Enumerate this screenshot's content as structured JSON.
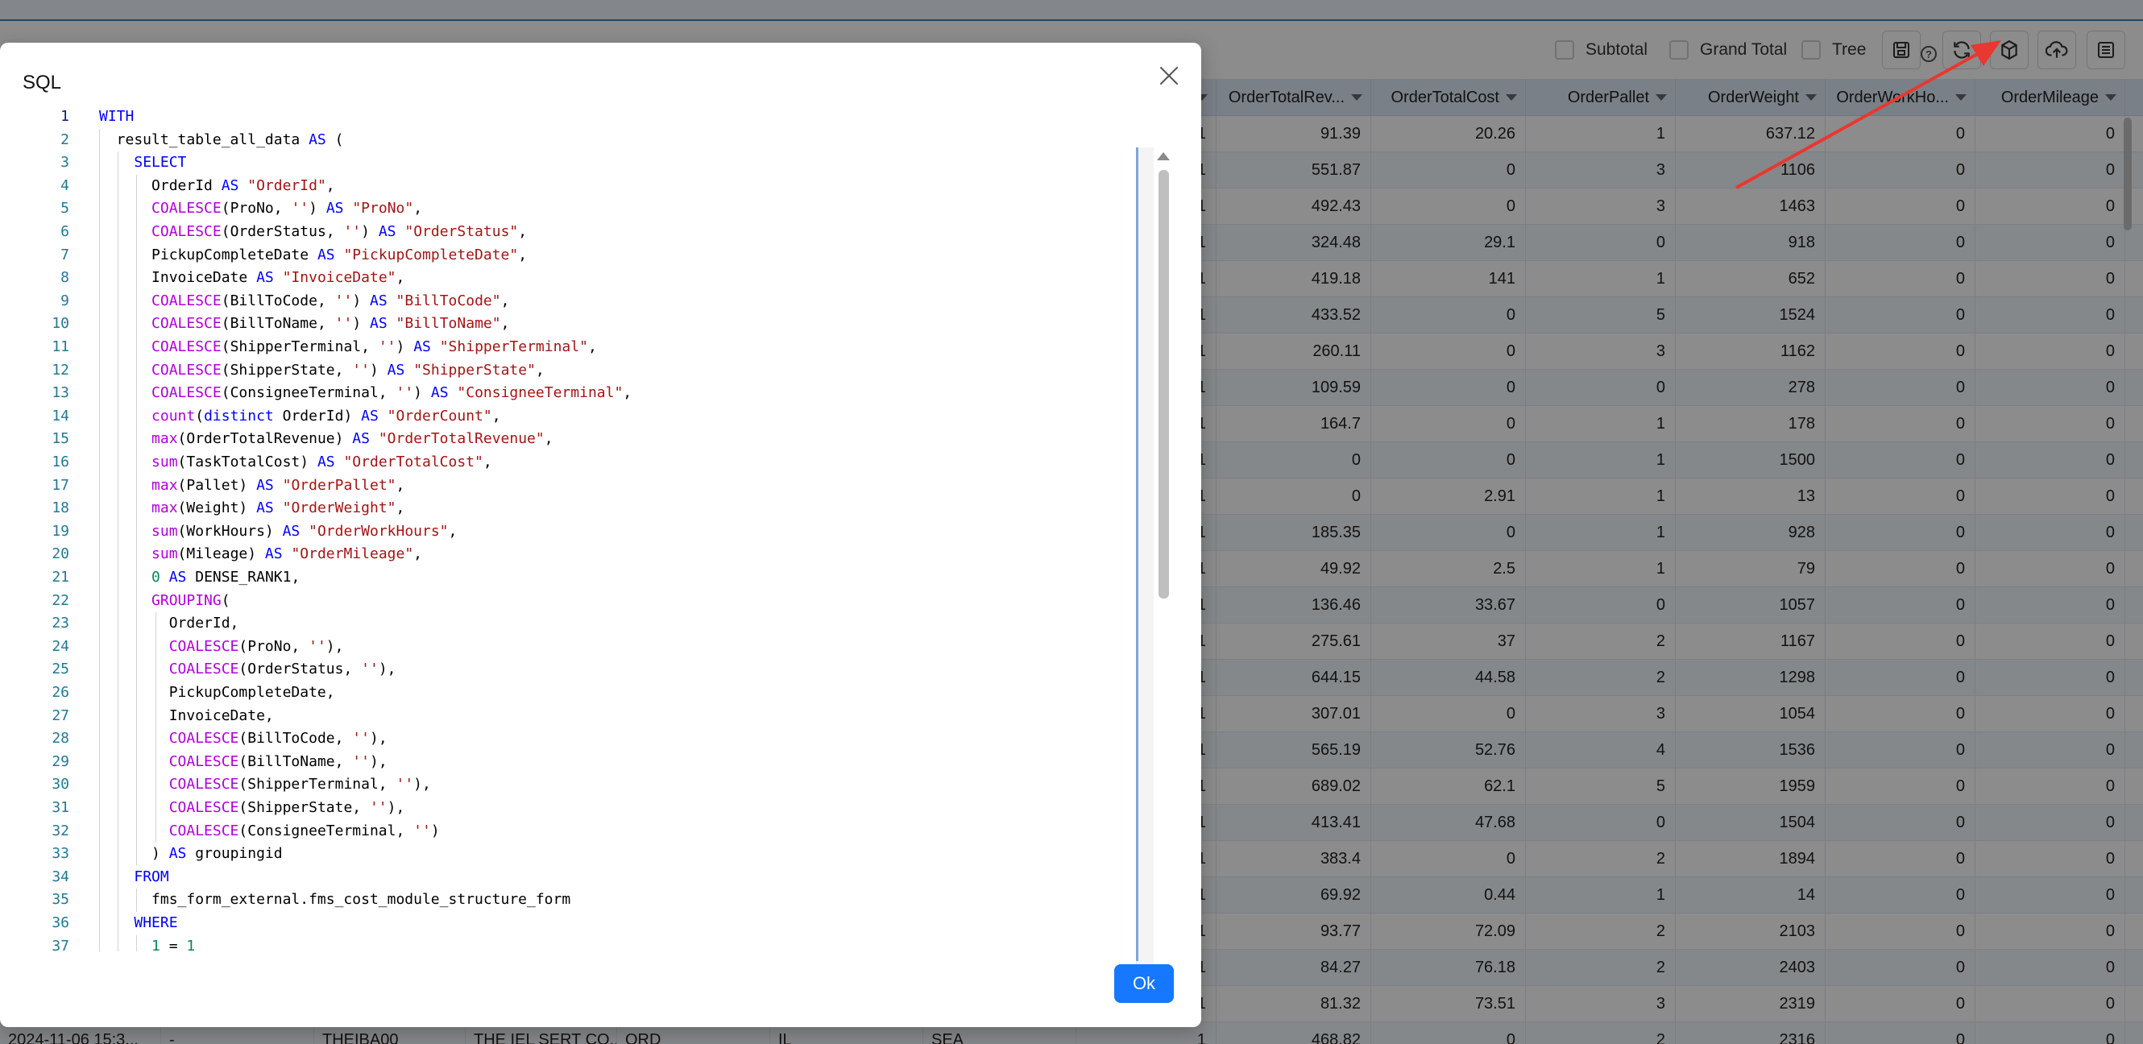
{
  "toolbar": {
    "subtotal_label": "Subtotal",
    "grand_total_label": "Grand Total",
    "tree_label": "Tree",
    "help_glyph": "?",
    "icons": [
      "save-icon",
      "help-icon",
      "refresh-icon",
      "cube-icon",
      "cloud-upload-icon",
      "list-icon"
    ]
  },
  "grid": {
    "columns": [
      "OrderTotalRev...",
      "OrderTotalCost",
      "OrderPallet",
      "OrderWeight",
      "OrderWorkHo...",
      "OrderMileage"
    ],
    "rows": [
      [
        "1",
        "91.39",
        "20.26",
        "1",
        "637.12",
        "0",
        "0"
      ],
      [
        "1",
        "551.87",
        "0",
        "3",
        "1106",
        "0",
        "0"
      ],
      [
        "1",
        "492.43",
        "0",
        "3",
        "1463",
        "0",
        "0"
      ],
      [
        "1",
        "324.48",
        "29.1",
        "0",
        "918",
        "0",
        "0"
      ],
      [
        "1",
        "419.18",
        "141",
        "1",
        "652",
        "0",
        "0"
      ],
      [
        "1",
        "433.52",
        "0",
        "5",
        "1524",
        "0",
        "0"
      ],
      [
        "1",
        "260.11",
        "0",
        "3",
        "1162",
        "0",
        "0"
      ],
      [
        "1",
        "109.59",
        "0",
        "0",
        "278",
        "0",
        "0"
      ],
      [
        "1",
        "164.7",
        "0",
        "1",
        "178",
        "0",
        "0"
      ],
      [
        "1",
        "0",
        "0",
        "1",
        "1500",
        "0",
        "0"
      ],
      [
        "1",
        "0",
        "2.91",
        "1",
        "13",
        "0",
        "0"
      ],
      [
        "1",
        "185.35",
        "0",
        "1",
        "928",
        "0",
        "0"
      ],
      [
        "1",
        "49.92",
        "2.5",
        "1",
        "79",
        "0",
        "0"
      ],
      [
        "1",
        "136.46",
        "33.67",
        "0",
        "1057",
        "0",
        "0"
      ],
      [
        "1",
        "275.61",
        "37",
        "2",
        "1167",
        "0",
        "0"
      ],
      [
        "1",
        "644.15",
        "44.58",
        "2",
        "1298",
        "0",
        "0"
      ],
      [
        "1",
        "307.01",
        "0",
        "3",
        "1054",
        "0",
        "0"
      ],
      [
        "1",
        "565.19",
        "52.76",
        "4",
        "1536",
        "0",
        "0"
      ],
      [
        "1",
        "689.02",
        "62.1",
        "5",
        "1959",
        "0",
        "0"
      ],
      [
        "1",
        "413.41",
        "47.68",
        "0",
        "1504",
        "0",
        "0"
      ],
      [
        "1",
        "383.4",
        "0",
        "2",
        "1894",
        "0",
        "0"
      ],
      [
        "1",
        "69.92",
        "0.44",
        "1",
        "14",
        "0",
        "0"
      ],
      [
        "1",
        "93.77",
        "72.09",
        "2",
        "2103",
        "0",
        "0"
      ],
      [
        "1",
        "84.27",
        "76.18",
        "2",
        "2403",
        "0",
        "0"
      ],
      [
        "1",
        "81.32",
        "73.51",
        "3",
        "2319",
        "0",
        "0"
      ],
      [
        "1",
        "468.82",
        "0",
        "2",
        "2316",
        "0",
        "0"
      ]
    ],
    "bottom_row_left": [
      "2024-11-06 15:3...",
      "-",
      "THEIBA00",
      "THE IEL SERT CO...",
      "ORD",
      "IL",
      "SEA"
    ]
  },
  "modal": {
    "title": "SQL",
    "ok_label": "Ok",
    "sql_lines": [
      "WITH",
      "  result_table_all_data AS (",
      "    SELECT",
      "      OrderId AS \"OrderId\",",
      "      COALESCE(ProNo, '') AS \"ProNo\",",
      "      COALESCE(OrderStatus, '') AS \"OrderStatus\",",
      "      PickupCompleteDate AS \"PickupCompleteDate\",",
      "      InvoiceDate AS \"InvoiceDate\",",
      "      COALESCE(BillToCode, '') AS \"BillToCode\",",
      "      COALESCE(BillToName, '') AS \"BillToName\",",
      "      COALESCE(ShipperTerminal, '') AS \"ShipperTerminal\",",
      "      COALESCE(ShipperState, '') AS \"ShipperState\",",
      "      COALESCE(ConsigneeTerminal, '') AS \"ConsigneeTerminal\",",
      "      count(distinct OrderId) AS \"OrderCount\",",
      "      max(OrderTotalRevenue) AS \"OrderTotalRevenue\",",
      "      sum(TaskTotalCost) AS \"OrderTotalCost\",",
      "      max(Pallet) AS \"OrderPallet\",",
      "      max(Weight) AS \"OrderWeight\",",
      "      sum(WorkHours) AS \"OrderWorkHours\",",
      "      sum(Mileage) AS \"OrderMileage\",",
      "      0 AS DENSE_RANK1,",
      "      GROUPING(",
      "        OrderId,",
      "        COALESCE(ProNo, ''),",
      "        COALESCE(OrderStatus, ''),",
      "        PickupCompleteDate,",
      "        InvoiceDate,",
      "        COALESCE(BillToCode, ''),",
      "        COALESCE(BillToName, ''),",
      "        COALESCE(ShipperTerminal, ''),",
      "        COALESCE(ShipperState, ''),",
      "        COALESCE(ConsigneeTerminal, '')",
      "      ) AS groupingid",
      "    FROM",
      "      fms_form_external.fms_cost_module_structure_form",
      "    WHERE",
      "      1 = 1"
    ]
  },
  "colors": {
    "accent": "#1677ff",
    "keyword": "#0000ff",
    "function": "#af00db",
    "string": "#a31515",
    "number": "#098658",
    "annotation_arrow": "#e8382f"
  }
}
